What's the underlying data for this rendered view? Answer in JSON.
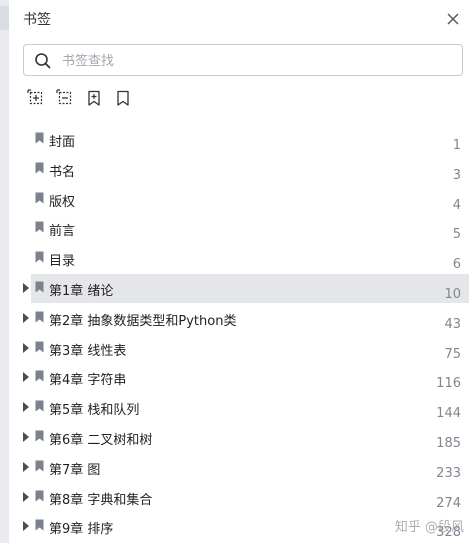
{
  "panel": {
    "title": "书签",
    "close_icon": "close-icon"
  },
  "search": {
    "placeholder": "书签查找",
    "value": ""
  },
  "toolbar": {
    "icons": [
      "expand-all-icon",
      "collapse-all-icon",
      "add-bookmark-icon",
      "bookmark-icon"
    ]
  },
  "bookmarks": [
    {
      "label": "封面",
      "page": "1",
      "expandable": false,
      "selected": false
    },
    {
      "label": "书名",
      "page": "3",
      "expandable": false,
      "selected": false
    },
    {
      "label": "版权",
      "page": "4",
      "expandable": false,
      "selected": false
    },
    {
      "label": "前言",
      "page": "5",
      "expandable": false,
      "selected": false
    },
    {
      "label": "目录",
      "page": "6",
      "expandable": false,
      "selected": false
    },
    {
      "label": "第1章 绪论",
      "page": "10",
      "expandable": true,
      "selected": true
    },
    {
      "label": "第2章 抽象数据类型和Python类",
      "page": "43",
      "expandable": true,
      "selected": false
    },
    {
      "label": "第3章 线性表",
      "page": "75",
      "expandable": true,
      "selected": false
    },
    {
      "label": "第4章 字符串",
      "page": "116",
      "expandable": true,
      "selected": false
    },
    {
      "label": "第5章 栈和队列",
      "page": "144",
      "expandable": true,
      "selected": false
    },
    {
      "label": "第6章 二叉树和树",
      "page": "185",
      "expandable": true,
      "selected": false
    },
    {
      "label": "第7章 图",
      "page": "233",
      "expandable": true,
      "selected": false
    },
    {
      "label": "第8章 字典和集合",
      "page": "274",
      "expandable": true,
      "selected": false
    },
    {
      "label": "第9章 排序",
      "page": "328",
      "expandable": true,
      "selected": false
    }
  ],
  "watermark": "知乎 @段风",
  "colors": {
    "selected_row": "#e4e6ea",
    "page_number": "#808790",
    "border": "#c7cbd1"
  }
}
